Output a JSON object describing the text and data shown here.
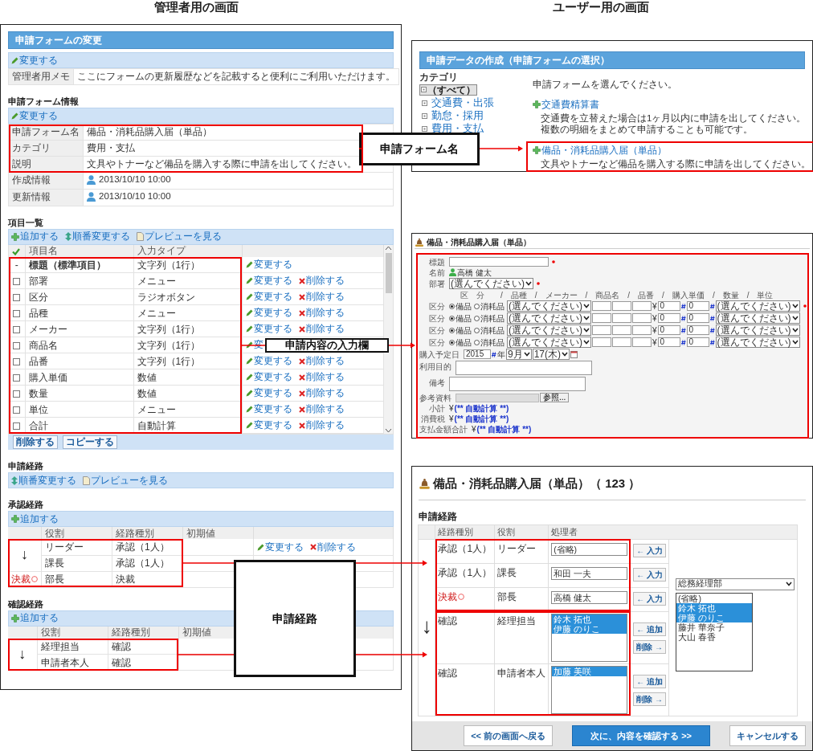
{
  "headings": [
    "管理者用の画面",
    "ユーザー用の画面"
  ],
  "admin": {
    "title": "申請フォームの変更",
    "memo": {
      "action": {
        "kind": "edit",
        "label": "変更する"
      },
      "label": "管理者用メモ",
      "value": "ここにフォームの更新履歴などを記載すると便利にご利用いただけます。"
    },
    "info": {
      "heading": "申請フォーム情報",
      "action": {
        "kind": "edit",
        "label": "変更する"
      },
      "rows": [
        {
          "label": "申請フォーム名",
          "value": "備品・消耗品購入届（単品）",
          "kind": "text",
          "highlighted": true
        },
        {
          "label": "カテゴリ",
          "value": "費用・支払",
          "kind": "text",
          "highlighted": true
        },
        {
          "label": "説明",
          "value": "文具やトナーなど備品を購入する際に申請を出してください。",
          "kind": "text",
          "highlighted": true
        },
        {
          "label": "作成情報",
          "value": "2013/10/10 10:00",
          "kind": "user",
          "highlighted": false
        },
        {
          "label": "更新情報",
          "value": "2013/10/10 10:00",
          "kind": "user",
          "highlighted": false
        }
      ]
    },
    "items": {
      "heading": "項目一覧",
      "actions": [
        {
          "kind": "add",
          "label": "追加する"
        },
        {
          "kind": "order",
          "label": "順番変更する"
        },
        {
          "kind": "preview",
          "label": "プレビューを見る"
        }
      ],
      "columns": [
        "項目名",
        "入力タイプ"
      ],
      "rows": [
        {
          "kind": "fixed",
          "marker": "-",
          "name": "標題（標準項目）",
          "type": "文字列（1行）",
          "edit": "変更する",
          "highlighted": true
        },
        {
          "kind": "custom",
          "checked": false,
          "name": "部署",
          "type": "メニュー",
          "edit": "変更する",
          "delete": "削除する",
          "highlighted": true
        },
        {
          "kind": "custom",
          "checked": false,
          "name": "区分",
          "type": "ラジオボタン",
          "edit": "変更する",
          "delete": "削除する",
          "highlighted": true
        },
        {
          "kind": "custom",
          "checked": false,
          "name": "品種",
          "type": "メニュー",
          "edit": "変更する",
          "delete": "削除する",
          "highlighted": true
        },
        {
          "kind": "custom",
          "checked": false,
          "name": "メーカー",
          "type": "文字列（1行）",
          "edit": "変更する",
          "delete": "削除する",
          "highlighted": true
        },
        {
          "kind": "custom",
          "checked": false,
          "name": "商品名",
          "type": "文字列（1行）",
          "edit": "変",
          "highlighted": true
        },
        {
          "kind": "custom",
          "checked": false,
          "name": "品番",
          "type": "文字列（1行）",
          "edit": "変更する",
          "delete": "削除する",
          "highlighted": true
        },
        {
          "kind": "custom",
          "checked": false,
          "name": "購入単価",
          "type": "数値",
          "edit": "変更する",
          "delete": "削除する",
          "highlighted": true
        },
        {
          "kind": "custom",
          "checked": false,
          "name": "数量",
          "type": "数値",
          "edit": "変更する",
          "delete": "削除する",
          "highlighted": true
        },
        {
          "kind": "custom",
          "checked": false,
          "name": "単位",
          "type": "メニュー",
          "edit": "変更する",
          "delete": "削除する",
          "highlighted": true
        },
        {
          "kind": "custom",
          "checked": false,
          "name": "合計",
          "type": "自動計算",
          "edit": "変更する",
          "delete": "削除する",
          "highlighted": true
        }
      ],
      "buttons": [
        "削除する",
        "コピーする"
      ]
    },
    "route": {
      "heading": "申請経路",
      "actions": [
        {
          "kind": "order",
          "label": "順番変更する"
        },
        {
          "kind": "preview",
          "label": "プレビューを見る"
        }
      ]
    },
    "paths": [
      {
        "heading": "承認経路",
        "action": {
          "kind": "add",
          "label": "追加する"
        },
        "columns": [
          "役割",
          "経路種別",
          "初期値"
        ],
        "arrow": "↓",
        "rows": [
          {
            "role": "リーダー",
            "type": "承認（1人）",
            "edit": "変更する",
            "delete": "削除する",
            "highlighted": true
          },
          {
            "role": "課長",
            "type": "承認（1人）",
            "highlighted": true
          },
          {
            "role": "部長",
            "type": "決裁",
            "stamp": "決裁",
            "highlighted": true
          }
        ]
      },
      {
        "heading": "確認経路",
        "action": {
          "kind": "add",
          "label": "追加する"
        },
        "columns": [
          "役割",
          "経路種別",
          "初期値"
        ],
        "arrow": "↓",
        "rows": [
          {
            "role": "経理担当",
            "type": "確認",
            "highlighted": true
          },
          {
            "role": "申請者本人",
            "type": "確認",
            "highlighted": true
          }
        ]
      }
    ]
  },
  "user": {
    "select": {
      "title": "申請データの作成（申請フォームの選択）",
      "category_label": "カテゴリ",
      "categories": [
        {
          "label": "（すべて）",
          "selected": true
        },
        {
          "label": "交通費・出張",
          "selected": false
        },
        {
          "label": "勤怠・採用",
          "selected": false
        },
        {
          "label": "費用・支払",
          "selected": false
        }
      ],
      "prompt": "申請フォームを選んでください。",
      "forms": [
        {
          "name": "交通費精算書",
          "description": [
            "交通費を立替えた場合は1ヶ月以内に申請を出してください。",
            "複数の明細をまとめて申請することも可能です。"
          ],
          "highlighted": false
        },
        {
          "name": "備品・消耗品購入届（単品）",
          "description": [
            "文具やトナーなど備品を購入する際に申請を出してください。"
          ],
          "highlighted": true
        }
      ]
    },
    "form": {
      "title": "備品・消耗品購入届（単品）",
      "highlighted": true,
      "fields": [
        {
          "kind": "input",
          "label": "標題",
          "required": true
        },
        {
          "kind": "user",
          "label": "名前",
          "value": "高橋 健太"
        },
        {
          "kind": "select",
          "label": "部署",
          "value": "(選んでください)",
          "required": true
        },
        {
          "kind": "header",
          "text": "区　分　　/　品種　/　メーカー　/　商品名　/　品番　/　購入単価　/　数量　/　単位"
        },
        {
          "kind": "detail",
          "label": "区分",
          "options": [
            {
              "label": "備品",
              "selected": true
            },
            {
              "label": "消耗品",
              "selected": false
            }
          ],
          "select": "(選んでください)",
          "currency": "¥",
          "price": "0",
          "quantity": "0",
          "unit": "(選んでください)",
          "required": true
        },
        {
          "kind": "detail",
          "label": "区分",
          "options": [
            {
              "label": "備品",
              "selected": true
            },
            {
              "label": "消耗品",
              "selected": false
            }
          ],
          "select": "(選んでください)",
          "currency": "¥",
          "price": "0",
          "quantity": "0",
          "unit": "(選んでください)",
          "required": false
        },
        {
          "kind": "detail",
          "label": "区分",
          "options": [
            {
              "label": "備品",
              "selected": true
            },
            {
              "label": "消耗品",
              "selected": false
            }
          ],
          "select": "(選んでください)",
          "currency": "¥",
          "price": "0",
          "quantity": "0",
          "unit": "(選んでください)",
          "required": false
        },
        {
          "kind": "detail",
          "label": "区分",
          "options": [
            {
              "label": "備品",
              "selected": true
            },
            {
              "label": "消耗品",
              "selected": false
            }
          ],
          "select": "(選んでください)",
          "currency": "¥",
          "price": "0",
          "quantity": "0",
          "unit": "(選んでください)",
          "required": false
        },
        {
          "kind": "date",
          "label": "購入予定日",
          "year": "2015",
          "year_suffix": "年",
          "month": "9月",
          "day": "17(木)"
        },
        {
          "kind": "textarea",
          "label": "利用目的"
        },
        {
          "kind": "textarea",
          "label": "備考"
        },
        {
          "kind": "file",
          "label": "参考資料",
          "button": "参照..."
        },
        {
          "kind": "calc",
          "label": "小計",
          "currency": "¥",
          "value": "(** 自動計算 **)"
        },
        {
          "kind": "calc",
          "label": "消費税",
          "currency": "¥",
          "value": "(** 自動計算 **)"
        },
        {
          "kind": "calc",
          "label": "支払金額合計",
          "currency": "¥",
          "value": "(** 自動計算 **)"
        }
      ]
    },
    "route": {
      "title": "備品・消耗品購入届（単品）（ 123 ）",
      "heading": "申請経路",
      "columns": [
        "経路種別",
        "役割",
        "処理者"
      ],
      "arrow": "↓",
      "approval_rows": [
        {
          "type": "承認（1人）",
          "role": "リーダー",
          "kind": "input",
          "value": "(省略)",
          "buttons": [
            "← 入力"
          ],
          "highlighted": true
        },
        {
          "type": "承認（1人）",
          "role": "課長",
          "kind": "input",
          "value": "和田 一夫",
          "buttons": [
            "← 入力"
          ],
          "highlighted": true
        },
        {
          "type": "決裁",
          "stamp": true,
          "role": "部長",
          "kind": "input",
          "value": "高橋 健太",
          "buttons": [
            "← 入力"
          ],
          "highlighted": true
        }
      ],
      "confirm_rows": [
        {
          "type": "確認",
          "role": "経理担当",
          "kind": "list",
          "names": [
            {
              "label": "鈴木 拓也",
              "selected": true
            },
            {
              "label": "伊藤 のりこ",
              "selected": true
            }
          ],
          "buttons": [
            "← 追加",
            "削除 →"
          ],
          "highlighted": true
        },
        {
          "type": "確認",
          "role": "申請者本人",
          "kind": "list",
          "names": [
            {
              "label": "加藤 美咲",
              "selected": true
            }
          ],
          "buttons": [
            "← 追加",
            "削除 →"
          ],
          "highlighted": true
        }
      ],
      "picker": {
        "department": "総務経理部",
        "names": [
          {
            "label": "(省略)",
            "selected": false
          },
          {
            "label": "鈴木 拓也",
            "selected": true
          },
          {
            "label": "伊藤 のりこ",
            "selected": true
          },
          {
            "label": "藤井 華奈子",
            "selected": false
          },
          {
            "label": "大山 春香",
            "selected": false
          }
        ]
      },
      "buttons": [
        {
          "kind": "back",
          "label": "<< 前の画面へ戻る"
        },
        {
          "kind": "primary",
          "label": "次に、内容を確認する >>"
        },
        {
          "kind": "cancel",
          "label": "キャンセルする"
        }
      ]
    }
  },
  "callouts": [
    {
      "label": "申請フォーム名"
    },
    {
      "label": "申請内容の入力欄"
    },
    {
      "label": "申請経路"
    }
  ]
}
